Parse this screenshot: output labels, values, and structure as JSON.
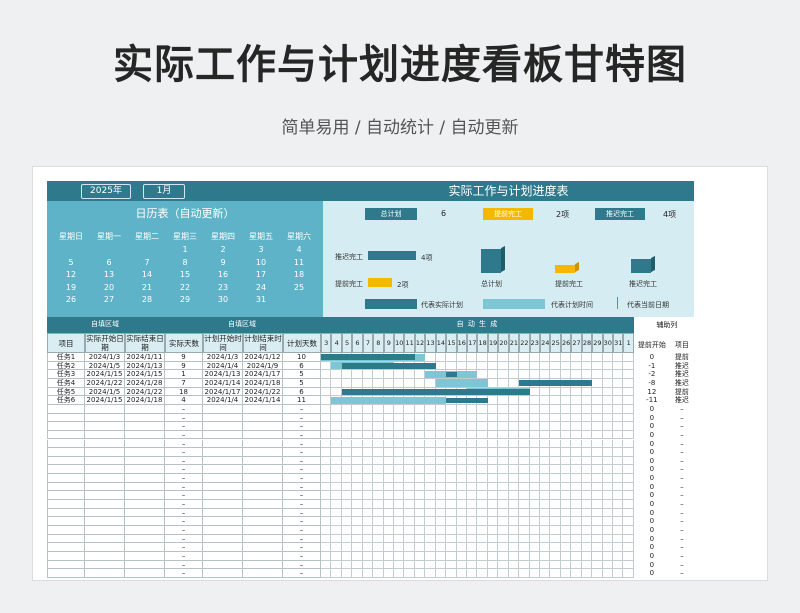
{
  "header": {
    "title": "实际工作与计划进度看板甘特图",
    "subtitle": "简单易用 / 自动统计 / 自动更新"
  },
  "calendar": {
    "year": "2025年",
    "month": "1月",
    "title": "日历表（自动更新）",
    "weekdays": [
      "星期日",
      "星期一",
      "星期二",
      "星期三",
      "星期四",
      "星期五",
      "星期六"
    ],
    "weeks": [
      [
        "",
        "",
        "",
        "1",
        "2",
        "3",
        "4"
      ],
      [
        "5",
        "6",
        "7",
        "8",
        "9",
        "10",
        "11"
      ],
      [
        "12",
        "13",
        "14",
        "15",
        "16",
        "17",
        "18"
      ],
      [
        "19",
        "20",
        "21",
        "22",
        "23",
        "24",
        "25"
      ],
      [
        "26",
        "27",
        "28",
        "29",
        "30",
        "31",
        ""
      ]
    ]
  },
  "summary": {
    "title": "实际工作与计划进度表",
    "total_label": "总计划",
    "total_value": "6",
    "early_label": "提前完工",
    "early_value": "2项",
    "late_label": "推迟完工",
    "late_value": "4项",
    "bars": [
      {
        "label": "推迟完工",
        "value": "4项",
        "amount": 4
      },
      {
        "label": "提前完工",
        "value": "2项",
        "amount": 2
      }
    ],
    "cubes": [
      {
        "label": "总计划"
      },
      {
        "label": "提前完工"
      },
      {
        "label": "推迟完工"
      }
    ],
    "legend": {
      "actual": "代表实际计划",
      "plan": "代表计划时间",
      "today": "代表当前日期"
    },
    "colors": {
      "actual": "#2e7a8c",
      "plan": "#7ec5d6",
      "early": "#f5b800",
      "today": "#e05a5a"
    }
  },
  "grid": {
    "section_input": "自填区域",
    "section_auto": "自  动  生  成",
    "section_aux": "辅助列",
    "columns": [
      "项目",
      "实际开始日期",
      "实际结束日期",
      "实际天数",
      "计划开始时间",
      "计划结束时间",
      "计划天数"
    ],
    "aux_columns": [
      "提前开始",
      "项目"
    ],
    "days": [
      "3",
      "4",
      "5",
      "6",
      "7",
      "8",
      "9",
      "10",
      "11",
      "12",
      "13",
      "14",
      "15",
      "16",
      "17",
      "18",
      "19",
      "20",
      "21",
      "22",
      "23",
      "24",
      "25",
      "26",
      "27",
      "28",
      "29",
      "30",
      "31",
      "1"
    ],
    "tasks": [
      {
        "name": "任务1",
        "a_start": "2024/1/3",
        "a_end": "2024/1/11",
        "a_days": "9",
        "p_start": "2024/1/3",
        "p_end": "2024/1/12",
        "p_days": "10",
        "aux1": "0",
        "aux2": "提前",
        "actual": [
          3,
          11
        ],
        "plan": [
          3,
          12
        ]
      },
      {
        "name": "任务2",
        "a_start": "2024/1/5",
        "a_end": "2024/1/13",
        "a_days": "9",
        "p_start": "2024/1/4",
        "p_end": "2024/1/9",
        "p_days": "6",
        "aux1": "-1",
        "aux2": "推迟",
        "actual": [
          5,
          13
        ],
        "plan": [
          4,
          9
        ]
      },
      {
        "name": "任务3",
        "a_start": "2024/1/15",
        "a_end": "2024/1/15",
        "a_days": "1",
        "p_start": "2024/1/13",
        "p_end": "2024/1/17",
        "p_days": "5",
        "aux1": "-2",
        "aux2": "推迟",
        "actual": [
          15,
          15
        ],
        "plan": [
          13,
          17
        ]
      },
      {
        "name": "任务4",
        "a_start": "2024/1/22",
        "a_end": "2024/1/28",
        "a_days": "7",
        "p_start": "2024/1/14",
        "p_end": "2024/1/18",
        "p_days": "5",
        "aux1": "-8",
        "aux2": "推迟",
        "actual": [
          22,
          28
        ],
        "plan": [
          14,
          18
        ]
      },
      {
        "name": "任务5",
        "a_start": "2024/1/5",
        "a_end": "2024/1/22",
        "a_days": "18",
        "p_start": "2024/1/17",
        "p_end": "2024/1/22",
        "p_days": "6",
        "aux1": "12",
        "aux2": "提前",
        "actual": [
          5,
          22
        ],
        "plan": [
          17,
          22
        ]
      },
      {
        "name": "任务6",
        "a_start": "2024/1/15",
        "a_end": "2024/1/18",
        "a_days": "4",
        "p_start": "2024/1/4",
        "p_end": "2024/1/14",
        "p_days": "11",
        "aux1": "-11",
        "aux2": "推迟",
        "actual": [
          15,
          18
        ],
        "plan": [
          4,
          14
        ]
      }
    ],
    "empty_dash": "–",
    "empty_zero": "0",
    "empty_rows": 20
  }
}
